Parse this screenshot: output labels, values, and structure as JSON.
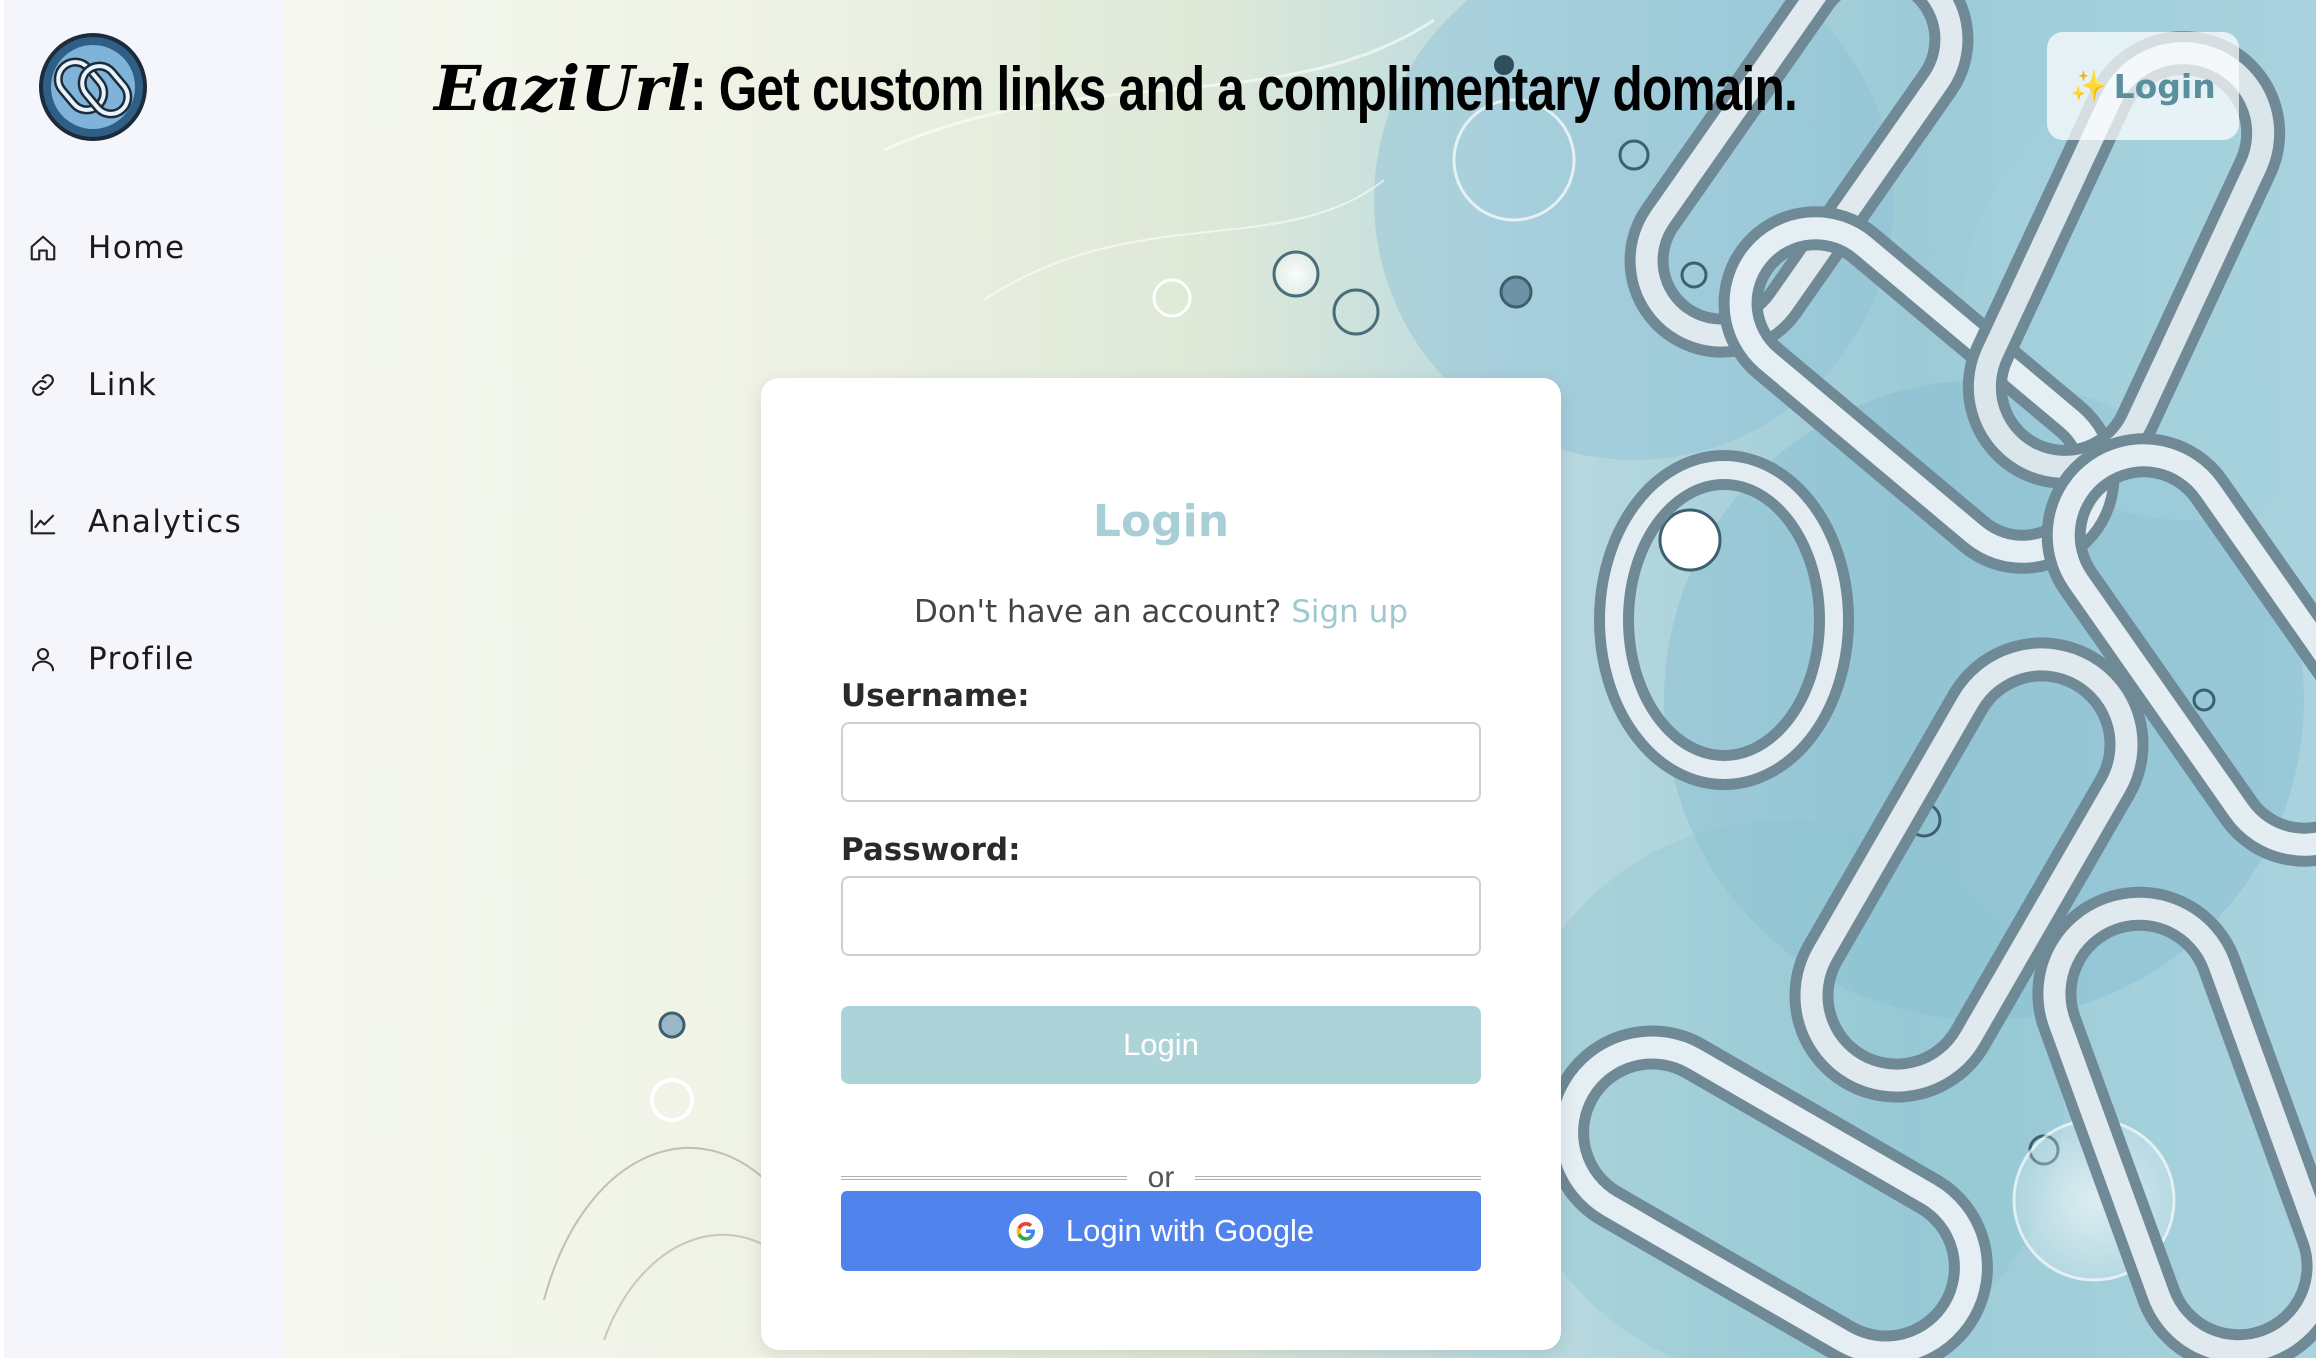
{
  "header": {
    "brand": "EaziUrl",
    "tagline": " : Get custom links and a complimentary domain.",
    "login_label": "Login",
    "login_icon": "sparkles-icon"
  },
  "sidebar": {
    "logo_icon": "chain-link-logo",
    "items": [
      {
        "label": "Home",
        "icon": "home-icon"
      },
      {
        "label": "Link",
        "icon": "link-icon"
      },
      {
        "label": "Analytics",
        "icon": "chart-line-icon"
      },
      {
        "label": "Profile",
        "icon": "user-icon"
      }
    ]
  },
  "login_card": {
    "title": "Login",
    "no_account_text": "Don't have an account?",
    "signup_link": "Sign up",
    "username_label": "Username:",
    "password_label": "Password:",
    "username_value": "",
    "password_value": "",
    "submit_label": "Login",
    "divider_text": "or",
    "google_label": "Login with Google",
    "google_icon": "google-g-icon"
  },
  "colors": {
    "accent": "#a8ced6",
    "login_button": "#acd3d8",
    "google_button": "#5084ec",
    "sidebar_bg": "#f4f6fb"
  }
}
